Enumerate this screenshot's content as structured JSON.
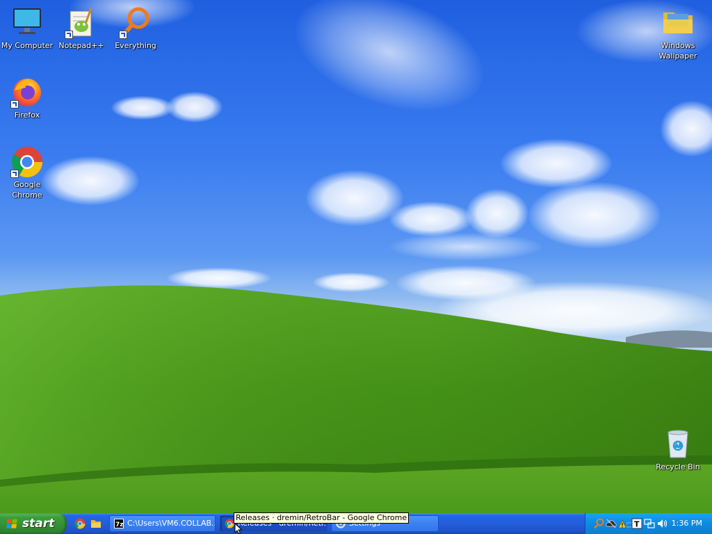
{
  "desktop": {
    "icons": [
      {
        "label": "My Computer",
        "icon": "my-computer-icon"
      },
      {
        "label": "Notepad++",
        "icon": "notepadpp-icon"
      },
      {
        "label": "Everything",
        "icon": "everything-search-icon"
      },
      {
        "label": "Firefox",
        "icon": "firefox-icon"
      },
      {
        "label": "Google\nChrome",
        "icon": "chrome-icon"
      },
      {
        "label": "Windows\nWallpaper",
        "icon": "folder-icon"
      },
      {
        "label": "Recycle Bin",
        "icon": "recycle-bin-icon"
      }
    ]
  },
  "taskbar": {
    "start_label": "start",
    "quick_launch": [
      {
        "icon": "chrome-icon"
      },
      {
        "icon": "folder-icon"
      }
    ],
    "tasks": [
      {
        "label": "C:\\Users\\VM6.COLLAB...",
        "icon": "7zip-icon",
        "active": false
      },
      {
        "label": "Releases · dremin/Retr...",
        "icon": "chrome-icon",
        "active": true
      },
      {
        "label": "Settings",
        "icon": "settings-icon",
        "active": false
      }
    ],
    "tray_icons": [
      "everything-search-icon",
      "onedrive-icon",
      "warning-icon",
      "network-adapter-icon",
      "text-input-icon",
      "network-icon",
      "volume-icon"
    ],
    "clock": "1:36 PM"
  },
  "tooltip": {
    "text": "Releases · dremin/RetroBar - Google Chrome"
  },
  "colors": {
    "sky_top": "#1f5fe0",
    "hill_green": "#4a9a1a",
    "taskbar_blue": "#245edb",
    "start_green": "#3a9e3a",
    "tray_blue": "#0f8be0",
    "tooltip_bg": "#ffffe1"
  }
}
